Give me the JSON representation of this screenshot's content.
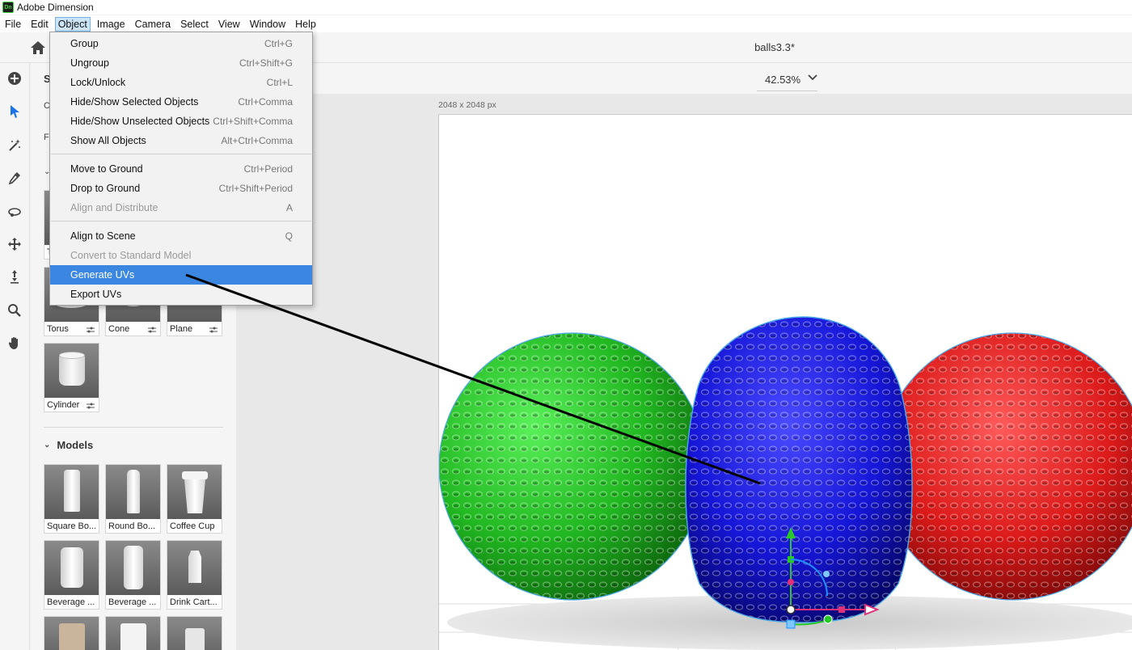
{
  "app": {
    "title": "Adobe Dimension",
    "logo_text": "Dn"
  },
  "menubar": [
    "File",
    "Edit",
    "Object",
    "Image",
    "Camera",
    "Select",
    "View",
    "Window",
    "Help"
  ],
  "header": {
    "doc_title": "balls3.3*"
  },
  "zoom": {
    "value": "42.53%"
  },
  "canvas": {
    "dims": "2048 x 2048 px"
  },
  "panel": {
    "cut_header": "S",
    "cut_c": "C",
    "cut_f": "F",
    "cut_t": "T",
    "shapes": [
      {
        "label": "Torus"
      },
      {
        "label": "Cone"
      },
      {
        "label": "Plane"
      },
      {
        "label": "Cylinder"
      }
    ],
    "models_heading": "Models",
    "models": [
      {
        "label": "Square Bo..."
      },
      {
        "label": "Round Bo..."
      },
      {
        "label": "Coffee Cup"
      },
      {
        "label": "Beverage ..."
      },
      {
        "label": "Beverage ..."
      },
      {
        "label": "Drink Cart..."
      }
    ]
  },
  "object_menu": {
    "items": [
      {
        "label": "Group",
        "shortcut": "Ctrl+G"
      },
      {
        "label": "Ungroup",
        "shortcut": "Ctrl+Shift+G"
      },
      {
        "label": "Lock/Unlock",
        "shortcut": "Ctrl+L"
      },
      {
        "label": "Hide/Show Selected Objects",
        "shortcut": "Ctrl+Comma"
      },
      {
        "label": "Hide/Show Unselected Objects",
        "shortcut": "Ctrl+Shift+Comma"
      },
      {
        "label": "Show All Objects",
        "shortcut": "Alt+Ctrl+Comma"
      },
      {
        "label": "Move to Ground",
        "shortcut": "Ctrl+Period"
      },
      {
        "label": "Drop to Ground",
        "shortcut": "Ctrl+Shift+Period"
      },
      {
        "label": "Align and Distribute",
        "shortcut": "A"
      },
      {
        "label": "Align to Scene",
        "shortcut": "Q"
      },
      {
        "label": "Convert to Standard Model",
        "shortcut": ""
      },
      {
        "label": "Generate UVs",
        "shortcut": ""
      },
      {
        "label": "Export UVs",
        "shortcut": ""
      }
    ]
  },
  "colors": {
    "highlight": "#3a86e0",
    "accent_tool": "#1a73e8",
    "ball_green": "#22c322",
    "ball_blue": "#1a1ae0",
    "ball_red": "#e01818"
  }
}
